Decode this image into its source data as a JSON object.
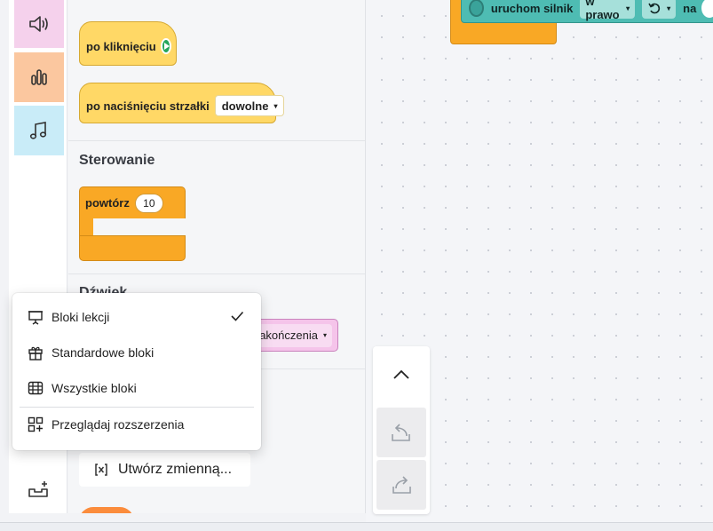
{
  "flyout": {
    "events": {
      "when_clicked": "po kliknięciu",
      "when_arrow_pressed": "po naciśnięciu strzałki",
      "arrow_option": "dowolne"
    },
    "control": {
      "title": "Sterowanie",
      "repeat_label": "powtórz",
      "repeat_value": "10"
    },
    "sound": {
      "title": "Dźwięk",
      "until_done_option": "akończenia"
    },
    "variables": {
      "make_variable": "Utwórz zmienną..."
    }
  },
  "workspace": {
    "motor_block": {
      "label": "uruchom silnik",
      "direction": "w prawo",
      "suffix": "na"
    }
  },
  "menu": {
    "items": [
      {
        "label": "Bloki lekcji",
        "icon": "presentation-icon",
        "checked": true
      },
      {
        "label": "Standardowe bloki",
        "icon": "gift-icon",
        "checked": false
      },
      {
        "label": "Wszystkie bloki",
        "icon": "grid-blocks-icon",
        "checked": false
      },
      {
        "label": "Przeglądaj rozszerzenia",
        "icon": "extensions-icon",
        "checked": false
      }
    ]
  },
  "colors": {
    "events": "#ffd866",
    "control": "#f9a825",
    "sound_category": "#f5d1ec",
    "data_category": "#fbc79f",
    "music_category": "#c9ecf8",
    "motor": "#4ebcb3"
  }
}
